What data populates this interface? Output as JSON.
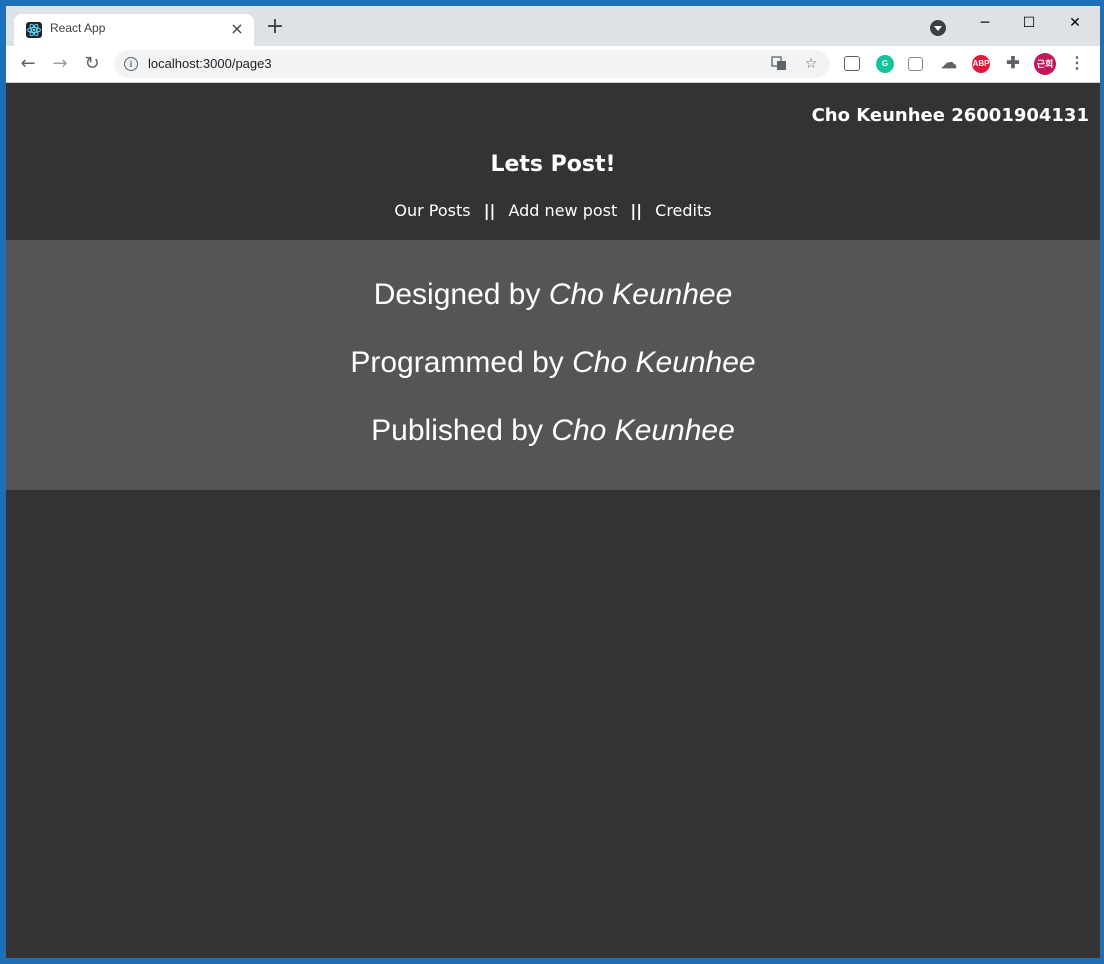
{
  "browser": {
    "tab_title": "React App",
    "tab_close": "×",
    "new_tab": "+",
    "url": "localhost:3000/page3",
    "profile_initials": "근희",
    "abp_label": "ABP",
    "grammarly_label": "G",
    "window_controls": {
      "minimize": "─",
      "maximize": "☐",
      "close": "✕"
    },
    "nav": {
      "back": "←",
      "forward": "→",
      "reload": "↻"
    }
  },
  "header": {
    "user_info": "Cho Keunhee 26001904131",
    "title": "Lets Post!",
    "nav_items": [
      "Our Posts",
      "Add new post",
      "Credits"
    ],
    "separator": "||"
  },
  "credits": {
    "lines": [
      {
        "label": "Designed by",
        "name": "Cho Keunhee"
      },
      {
        "label": "Programmed by",
        "name": "Cho Keunhee"
      },
      {
        "label": "Published by",
        "name": "Cho Keunhee"
      }
    ]
  },
  "colors": {
    "page_bg": "#333333",
    "credits_bg": "#555555",
    "text": "#ffffff",
    "desktop": "#1e6fb8"
  }
}
